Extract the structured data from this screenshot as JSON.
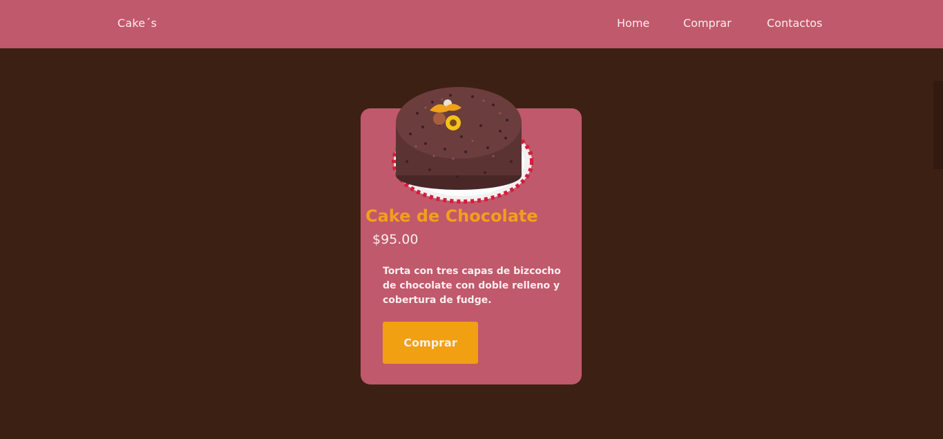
{
  "header": {
    "logo": "Cake´s",
    "nav": {
      "home": "Home",
      "buy": "Comprar",
      "contact": "Contactos"
    }
  },
  "product": {
    "image_icon": "cake-image",
    "title": "Cake de Chocolate",
    "price": "$95.00",
    "description": "Torta con tres capas de bizcocho de chocolate con doble relleno y cobertura de fudge.",
    "button_label": "Comprar"
  },
  "colors": {
    "header_bg": "#c0596b",
    "page_bg": "#3d2014",
    "card_bg": "#c0596b",
    "title": "#f2a01a",
    "button_bg": "#f0a011",
    "text_light": "#fbeef0"
  }
}
